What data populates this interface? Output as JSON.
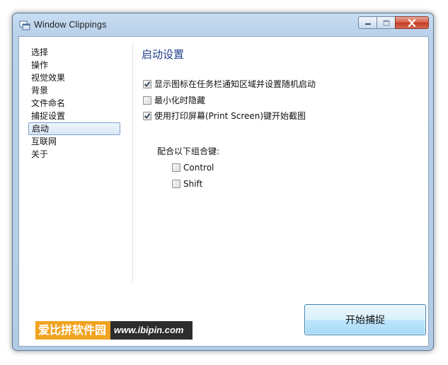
{
  "window": {
    "title": "Window Clippings",
    "controls": {
      "minimize": "minimize-icon",
      "maximize": "maximize-icon",
      "close": "close-icon"
    }
  },
  "sidebar": {
    "items": [
      {
        "label": "选择"
      },
      {
        "label": "操作"
      },
      {
        "label": "视觉效果"
      },
      {
        "label": "背景"
      },
      {
        "label": "文件命名"
      },
      {
        "label": "捕捉设置"
      },
      {
        "label": "启动",
        "selected": true
      },
      {
        "label": "互联网"
      },
      {
        "label": "关于"
      }
    ]
  },
  "main": {
    "section_title": "启动设置",
    "options": [
      {
        "label": "显示图标在任务栏通知区域并设置随机启动",
        "checked": true
      },
      {
        "label": "最小化时隐藏",
        "checked": false
      },
      {
        "label": "使用打印屏幕(Print Screen)键开始截图",
        "checked": true
      }
    ],
    "combo_label": "配合以下组合键:",
    "modifiers": [
      {
        "label": "Control",
        "checked": false
      },
      {
        "label": "Shift",
        "checked": false
      }
    ],
    "start_button": "开始捕捉"
  },
  "watermark": {
    "cn": "爱比拼软件园",
    "url": "www.ibipin.com"
  },
  "colors": {
    "accent": "#1e3f8a",
    "selection_border": "#7da2ce",
    "button_border": "#3c7fb1",
    "close_red": "#c53b23"
  }
}
